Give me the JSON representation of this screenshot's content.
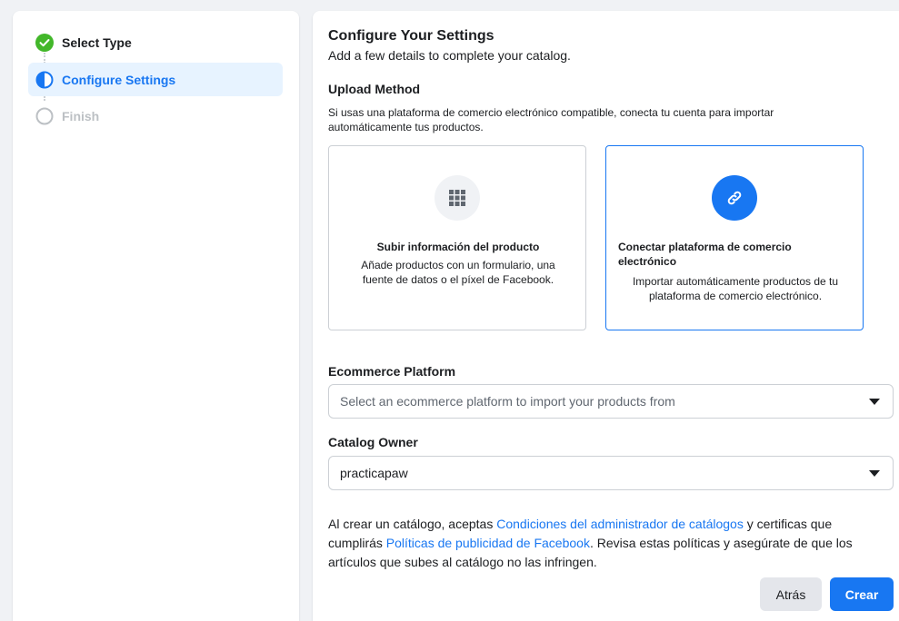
{
  "sidebar": {
    "steps": [
      {
        "label": "Select Type",
        "state": "done"
      },
      {
        "label": "Configure Settings",
        "state": "active"
      },
      {
        "label": "Finish",
        "state": "pending"
      }
    ]
  },
  "main": {
    "title": "Configure Your Settings",
    "subtitle": "Add a few details to complete your catalog.",
    "upload_method": {
      "label": "Upload Method",
      "description": "Si usas una plataforma de comercio electrónico compatible, conecta tu cuenta para importar automáticamente tus productos.",
      "options": [
        {
          "icon": "grid-icon",
          "title": "Subir información del producto",
          "description": "Añade productos con un formulario, una fuente de datos o el píxel de Facebook.",
          "selected": false
        },
        {
          "icon": "link-icon",
          "title": "Conectar plataforma de comercio electrónico",
          "description": "Importar automáticamente productos de tu plataforma de comercio electrónico.",
          "selected": true
        }
      ]
    },
    "ecommerce_platform": {
      "label": "Ecommerce Platform",
      "placeholder": "Select an ecommerce platform to import your products from"
    },
    "catalog_owner": {
      "label": "Catalog Owner",
      "value": "practicapaw"
    },
    "legal": {
      "part1": "Al crear un catálogo, aceptas ",
      "link1": "Condiciones del administrador de catálogos",
      "part2": " y certificas que cumplirás ",
      "link2": "Políticas de publicidad de Facebook",
      "part3": ". Revisa estas políticas y asegúrate de que los artículos que subes al catálogo no las infringen."
    },
    "buttons": {
      "back": "Atrás",
      "create": "Crear"
    }
  },
  "colors": {
    "accent": "#1877f2",
    "success": "#42b72a",
    "active_bg": "#e7f3ff"
  }
}
